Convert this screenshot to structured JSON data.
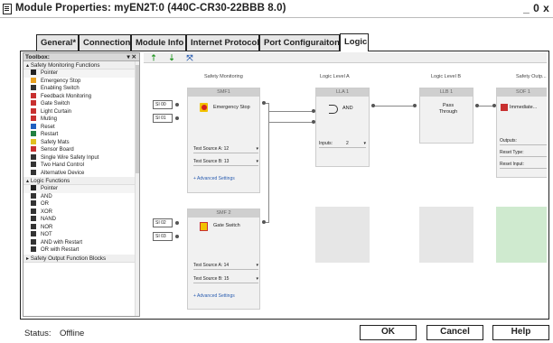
{
  "window": {
    "title": "Module Properties: myEN2T:0 (440C-CR30-22BBB 8.0)",
    "minimize_glyph": "_",
    "restore_glyph": "0",
    "close_glyph": "x"
  },
  "tabs": [
    {
      "label": "General*",
      "active": false
    },
    {
      "label": "Connection",
      "active": false
    },
    {
      "label": "Module Info",
      "active": false
    },
    {
      "label": "Internet Protocol",
      "active": false
    },
    {
      "label": "Port Configuraiton",
      "active": false
    },
    {
      "label": "Logic",
      "active": true
    }
  ],
  "toolbox": {
    "title": "Toolbox:",
    "header_buttons": "▾ ✕",
    "groups": [
      {
        "label": "▴ Safety Monitoring Functions",
        "items": [
          {
            "label": "Pointer",
            "icon": "pointer-icon",
            "color": "#222222"
          },
          {
            "label": "Emergency Stop",
            "icon": "emergency-stop-icon",
            "color": "#e8a020"
          },
          {
            "label": "Enabling Switch",
            "icon": "enabling-switch-icon",
            "color": "#333333"
          },
          {
            "label": "Feedback Monitoring",
            "icon": "feedback-icon",
            "color": "#c83030"
          },
          {
            "label": "Gate Switch",
            "icon": "gate-switch-icon",
            "color": "#c83030"
          },
          {
            "label": "Light Curtain",
            "icon": "light-curtain-icon",
            "color": "#c83030"
          },
          {
            "label": "Muting",
            "icon": "muting-icon",
            "color": "#c83030"
          },
          {
            "label": "Reset",
            "icon": "reset-icon",
            "color": "#2060c0"
          },
          {
            "label": "Restart",
            "icon": "restart-icon",
            "color": "#208040"
          },
          {
            "label": "Safety Mats",
            "icon": "safety-mats-icon",
            "color": "#e0c020"
          },
          {
            "label": "Sensor Board",
            "icon": "sensor-board-icon",
            "color": "#c83030"
          },
          {
            "label": "Single Wire Safety Input",
            "icon": "single-wire-icon",
            "color": "#333333"
          },
          {
            "label": "Two Hand Control",
            "icon": "two-hand-icon",
            "color": "#333333"
          },
          {
            "label": "Alternative Device",
            "icon": "alternative-device-icon",
            "color": "#333333"
          }
        ]
      },
      {
        "label": "▴ Logic Functions",
        "items": [
          {
            "label": "Pointer",
            "icon": "pointer-icon",
            "color": "#222222"
          },
          {
            "label": "AND",
            "icon": "and-gate-icon",
            "color": "#333333"
          },
          {
            "label": "OR",
            "icon": "or-gate-icon",
            "color": "#333333"
          },
          {
            "label": "XOR",
            "icon": "xor-gate-icon",
            "color": "#333333"
          },
          {
            "label": "NAND",
            "icon": "nand-gate-icon",
            "color": "#333333"
          },
          {
            "label": "NOR",
            "icon": "nor-gate-icon",
            "color": "#333333"
          },
          {
            "label": "NOT",
            "icon": "not-gate-icon",
            "color": "#333333"
          },
          {
            "label": "AND with Restart",
            "icon": "and-restart-icon",
            "color": "#333333"
          },
          {
            "label": "OR with Restart",
            "icon": "or-restart-icon",
            "color": "#333333"
          }
        ]
      },
      {
        "label": "▸ Safety Output Function Blocks",
        "items": []
      }
    ]
  },
  "canvas_toolbar": {
    "buttons": [
      {
        "name": "move-up-icon",
        "glyph": "⇡",
        "color": "#2a9a2a"
      },
      {
        "name": "move-down-icon",
        "glyph": "⇣",
        "color": "#2a9a2a"
      },
      {
        "name": "fit-view-icon",
        "glyph": "⤧",
        "color": "#2a5db0"
      }
    ]
  },
  "columns": {
    "safety_monitoring": "Safety Monitoring",
    "logic_level_a": "Logic Level A",
    "logic_level_b": "Logic Level B",
    "safety_outputs": "Safety Outp..."
  },
  "blocks": {
    "smf1": {
      "id": "SMF1",
      "name": "Emergency Stop",
      "inputs": [
        "SI 00",
        "SI 01"
      ],
      "fields": [
        "Test Source A:  12",
        "Test Source B:  13"
      ],
      "advanced": "+ Advanced Settings"
    },
    "smf2": {
      "id": "SMF 2",
      "name": "Gate Switch",
      "inputs": [
        "SI 02",
        "SI 03"
      ],
      "fields": [
        "Test Source A:  14",
        "Test Source B:  15"
      ],
      "advanced": "+ Advanced Settings"
    },
    "la1": {
      "id": "LLA 1",
      "name": "AND",
      "inputs_label": "Inputs:",
      "inputs_value": "2"
    },
    "lb1": {
      "id": "LLB 1",
      "name": "Pass Through"
    },
    "sof1": {
      "id": "SOF 1",
      "name": "Immediate...",
      "fields": [
        {
          "label": "Outputs:",
          "value": ""
        },
        {
          "label": "Reset Type:",
          "value": ""
        },
        {
          "label": "Reset Input:",
          "value": ""
        }
      ]
    }
  },
  "status": {
    "label": "Status:",
    "value": "Offline"
  },
  "buttons": {
    "ok": "OK",
    "cancel": "Cancel",
    "help": "Help"
  },
  "colors": {
    "accent_link": "#2a5db0",
    "placeholder_green": "#cfeacf"
  }
}
